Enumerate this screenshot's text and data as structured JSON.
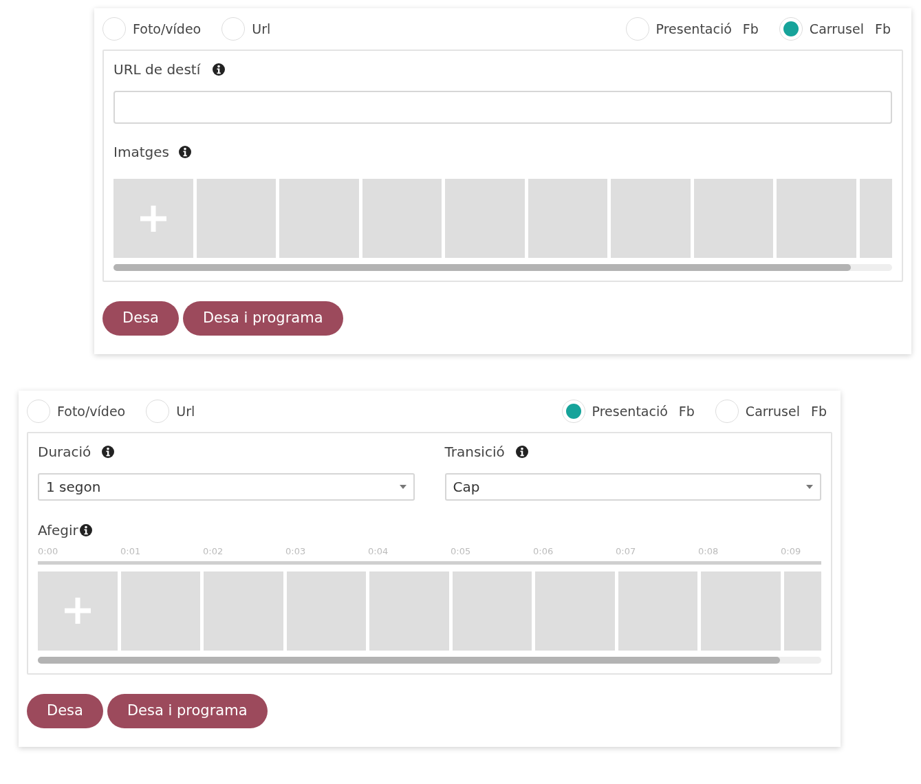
{
  "panels": [
    {
      "kind": "carousel",
      "options": [
        {
          "label": "Foto/vídeo",
          "selected": false
        },
        {
          "label": "Url",
          "selected": false
        },
        {
          "label": "Presentació Fb",
          "selected": false
        },
        {
          "label": "Carrusel Fb",
          "selected": true
        }
      ],
      "url_label": "URL de destí",
      "images_label": "Imatges",
      "tiles": [
        {
          "kind": "add"
        },
        {
          "kind": "empty"
        },
        {
          "kind": "empty"
        },
        {
          "kind": "empty"
        },
        {
          "kind": "empty"
        },
        {
          "kind": "empty"
        },
        {
          "kind": "empty"
        },
        {
          "kind": "empty"
        },
        {
          "kind": "empty"
        },
        {
          "kind": "empty"
        }
      ],
      "buttons": [
        "Desa",
        "Desa i programa"
      ]
    },
    {
      "kind": "slideshow",
      "options": [
        {
          "label": "Foto/vídeo",
          "selected": false
        },
        {
          "label": "Url",
          "selected": false
        },
        {
          "label": "Presentació Fb",
          "selected": true
        },
        {
          "label": "Carrusel Fb",
          "selected": false
        }
      ],
      "duration": {
        "label": "Duració",
        "value": "1 segon"
      },
      "transition": {
        "label": "Transició",
        "value": "Cap"
      },
      "images_label": "Afegir",
      "ticks": [
        "0:00",
        "0:01",
        "0:02",
        "0:03",
        "0:04",
        "0:05",
        "0:06",
        "0:07",
        "0:08",
        "0:09"
      ],
      "tiles": [
        {
          "kind": "add"
        },
        {
          "kind": "empty"
        },
        {
          "kind": "empty"
        },
        {
          "kind": "empty"
        },
        {
          "kind": "empty"
        },
        {
          "kind": "empty"
        },
        {
          "kind": "empty"
        },
        {
          "kind": "empty"
        },
        {
          "kind": "empty"
        },
        {
          "kind": "empty"
        }
      ],
      "buttons": [
        "Desa",
        "Desa i programa"
      ]
    }
  ]
}
